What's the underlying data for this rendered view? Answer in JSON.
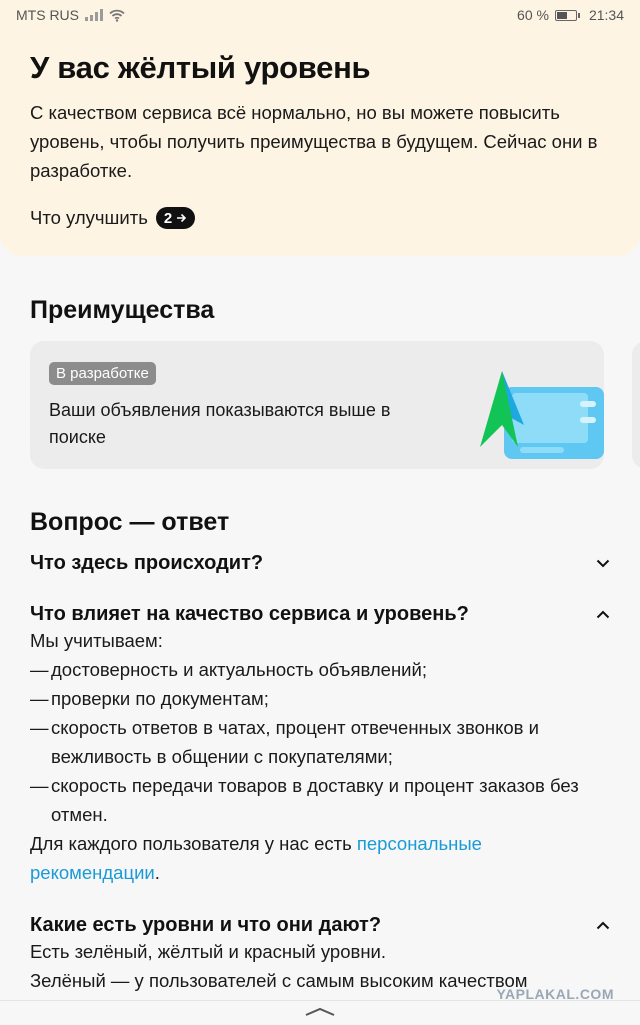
{
  "status_bar": {
    "carrier": "MTS RUS",
    "battery_text": "60 %",
    "battery_level": 0.6,
    "time": "21:34"
  },
  "level": {
    "title": "У вас жёлтый уровень",
    "description": "С качеством сервиса всё нормально, но вы можете повысить уровень, чтобы получить преимущества в будущем. Сейчас они в разработке.",
    "improve_label": "Что улучшить",
    "improve_count": "2"
  },
  "benefits": {
    "title": "Преимущества",
    "cards": [
      {
        "badge": "В разработке",
        "text": "Ваши объявления показываются выше в поиске"
      }
    ]
  },
  "faq": {
    "title": "Вопрос — ответ",
    "items": [
      {
        "question": "Что здесь происходит?",
        "expanded": false
      },
      {
        "question": "Что влияет на качество сервиса и уровень?",
        "expanded": true,
        "intro": "Мы учитываем:",
        "dash": "—",
        "points": [
          "достоверность и актуальность объявлений;",
          "проверки по документам;",
          "скорость ответов в чатах, процент отвеченных звонков и вежливость в общении с покупателями;",
          "скорость передачи товаров в доставку и процент заказов без отмен."
        ],
        "outro_text": "Для каждого пользователя у нас есть ",
        "outro_link": "персональные рекомендации",
        "outro_end": "."
      },
      {
        "question": "Какие есть уровни и что они дают?",
        "expanded": true,
        "lines": [
          "Есть зелёный, жёлтый и красный уровни.",
          "Зелёный — у пользователей с самым высоким качеством"
        ]
      }
    ]
  },
  "watermark": "YAPLAKAL.COM",
  "colors": {
    "accent_link": "#1a9bd7",
    "level_card_bg": "#fdf4e3",
    "badge_bg": "#8c8c8c"
  }
}
